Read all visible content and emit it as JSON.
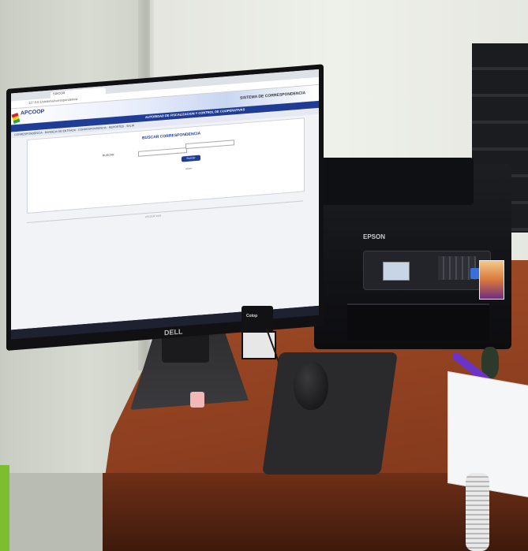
{
  "scene": {
    "description_colors": {
      "wall": "#e4e5df",
      "desk": "#8f4020",
      "monitor": "#111113",
      "printer": "#121316",
      "mousepad": "#2a2a2c",
      "pen": "#6b34c9"
    }
  },
  "monitor": {
    "brand": "DELL",
    "browser": {
      "tab_title": "SISCOR",
      "address": "127.0.0.1/sistema/correspondencia"
    },
    "website": {
      "logo_text": "APCOOP",
      "system_title": "SISTEMA DE CORRESPONDENCIA",
      "band_title": "AUTORIDAD DE FISCALIZACION Y CONTROL DE COOPERATIVAS",
      "nav_items": "CORRESPONDENCIA  ·  BANDEJA DE ENTRADA  ·  CORRESPONDENCIA  ·  REPORTES  ·  SALIR",
      "panel_title": "BUSCAR CORRESPONDENCIA",
      "search_label": "BUSCAR",
      "search_button": "Buscar",
      "small_link": "volver",
      "footer": "AFCOOP 2019"
    }
  },
  "printer": {
    "brand": "EPSON"
  },
  "stamp": {
    "label": "Colop"
  }
}
